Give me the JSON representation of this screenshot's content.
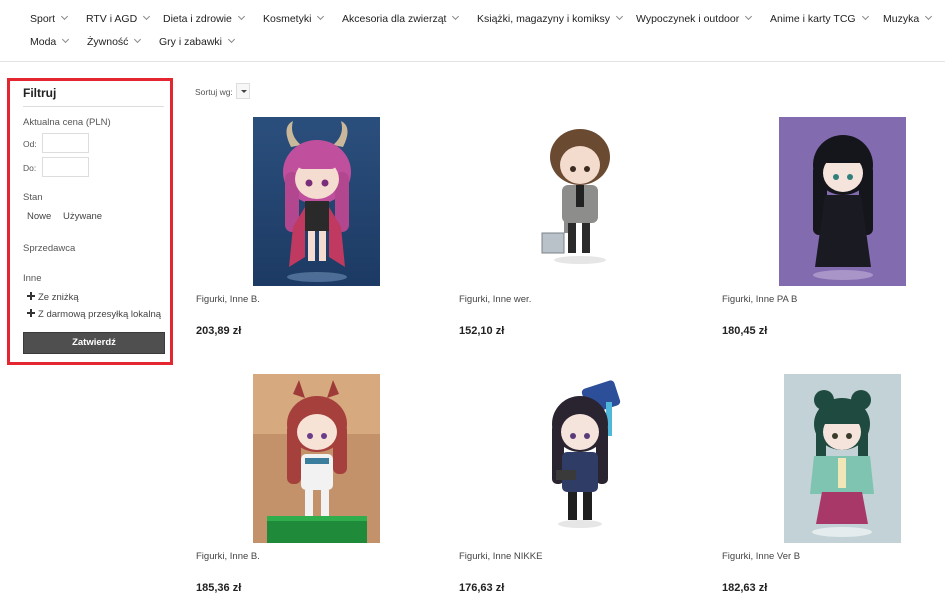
{
  "nav": {
    "categories": [
      "Sport",
      "RTV i AGD",
      "Dieta i zdrowie",
      "Kosmetyki",
      "Akcesoria dla zwierząt",
      "Książki, magazyny i komiksy",
      "Wypoczynek i outdoor",
      "Anime i karty TCG",
      "Muzyka",
      "Moda",
      "Żywność",
      "Gry i zabawki"
    ]
  },
  "filter": {
    "title": "Filtruj",
    "price_label": "Aktualna cena (PLN)",
    "from_label": "Od:",
    "to_label": "Do:",
    "from_value": "",
    "to_value": "",
    "condition_label": "Stan",
    "condition_new": "Nowe",
    "condition_used": "Używane",
    "seller_label": "Sprzedawca",
    "other_label": "Inne",
    "discount_label": "Ze zniżką",
    "free_shipping_label": "Z darmową przesyłką lokalną",
    "submit_label": "Zatwierdź",
    "accent_color": "#e3262f"
  },
  "sort": {
    "label": "Sortuj wg:",
    "selected": ""
  },
  "products": [
    {
      "name": "Figurki, Inne B.",
      "price": "203,89 zł",
      "image": "figure-horned-pink-hair"
    },
    {
      "name": "Figurki, Inne wer.",
      "price": "152,10 zł",
      "image": "figure-brown-hair-suitcase"
    },
    {
      "name": "Figurki, Inne PA B",
      "price": "180,45 zł",
      "image": "figure-black-hair-dress"
    },
    {
      "name": "Figurki, Inne B.",
      "price": "185,36 zł",
      "image": "figure-horse-girl-red-hair"
    },
    {
      "name": "Figurki, Inne NIKKE",
      "price": "176,63 zł",
      "image": "figure-police-cap-girl"
    },
    {
      "name": "Figurki, Inne Ver B",
      "price": "182,63 zł",
      "image": "figure-green-hair-hanfu"
    }
  ]
}
